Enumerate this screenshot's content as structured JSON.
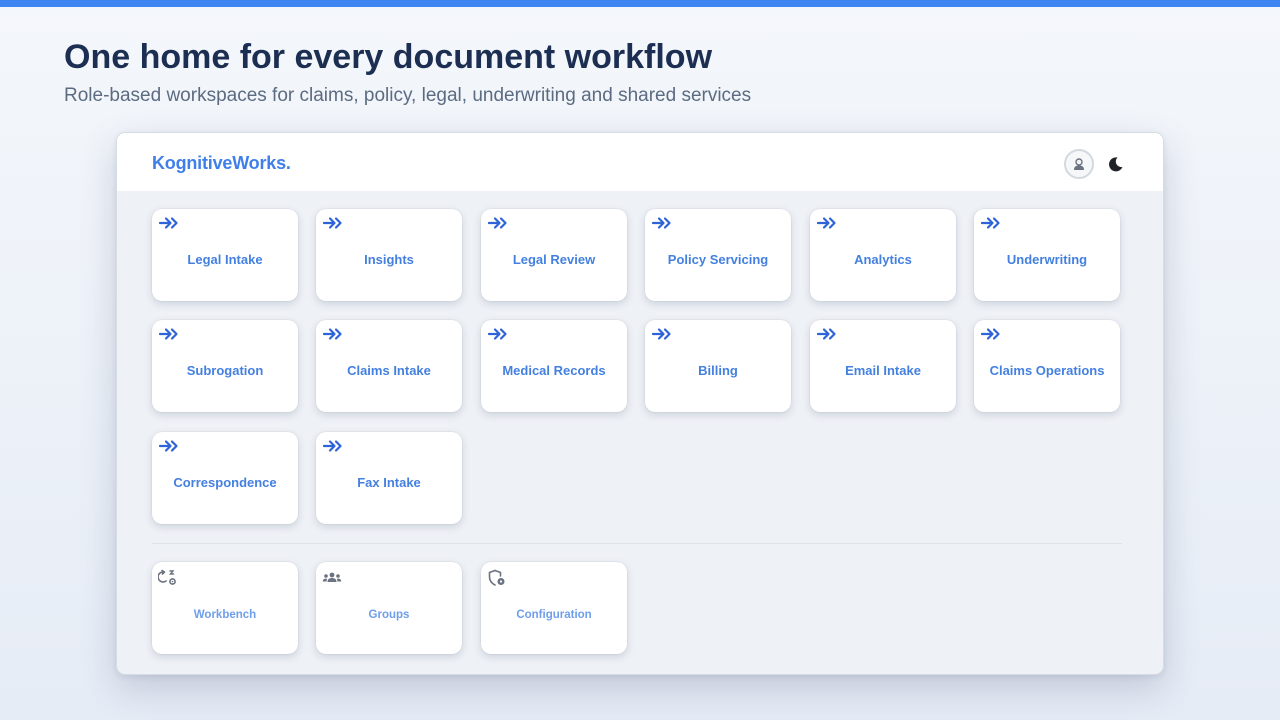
{
  "page": {
    "title": "One home for every document workflow",
    "subtitle": "Role-based workspaces for claims, policy, legal, underwriting and shared services"
  },
  "app": {
    "brand": "KognitiveWorks.",
    "header_icons": [
      "user-avatar-icon",
      "moon-icon"
    ],
    "accent_color": "#3f86f3"
  },
  "workspaces": [
    {
      "label": "Legal Intake",
      "icon": "double-arrow-right-icon"
    },
    {
      "label": "Insights",
      "icon": "double-arrow-right-icon"
    },
    {
      "label": "Legal Review",
      "icon": "double-arrow-right-icon"
    },
    {
      "label": "Policy Servicing",
      "icon": "double-arrow-right-icon"
    },
    {
      "label": "Analytics",
      "icon": "double-arrow-right-icon"
    },
    {
      "label": "Underwriting",
      "icon": "double-arrow-right-icon"
    },
    {
      "label": "Subrogation",
      "icon": "double-arrow-right-icon"
    },
    {
      "label": "Claims Intake",
      "icon": "double-arrow-right-icon"
    },
    {
      "label": "Medical Records",
      "icon": "double-arrow-right-icon"
    },
    {
      "label": "Billing",
      "icon": "double-arrow-right-icon"
    },
    {
      "label": "Email Intake",
      "icon": "double-arrow-right-icon"
    },
    {
      "label": "Claims Operations",
      "icon": "double-arrow-right-icon"
    },
    {
      "label": "Correspondence",
      "icon": "double-arrow-right-icon"
    },
    {
      "label": "Fax Intake",
      "icon": "double-arrow-right-icon"
    }
  ],
  "admin_tiles": [
    {
      "label": "Workbench",
      "icon": "workbench-settings-icon"
    },
    {
      "label": "Groups",
      "icon": "groups-icon"
    },
    {
      "label": "Configuration",
      "icon": "shield-settings-icon"
    }
  ]
}
